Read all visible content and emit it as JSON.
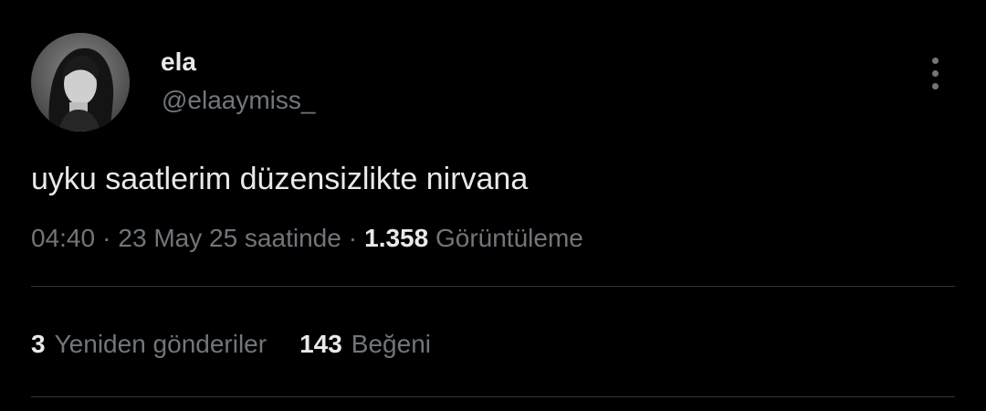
{
  "user": {
    "display_name": "ela",
    "handle": "@elaaymiss_"
  },
  "tweet": {
    "text": "uyku saatlerim düzensizlikte nirvana"
  },
  "meta": {
    "time": "04:40",
    "separator": "·",
    "date": "23 May 25 saatinde",
    "views_count": "1.358",
    "views_label": "Görüntüleme"
  },
  "stats": {
    "retweets_count": "3",
    "retweets_label": "Yeniden gönderiler",
    "likes_count": "143",
    "likes_label": "Beğeni"
  },
  "icons": {
    "more": "more-vertical-icon"
  },
  "colors": {
    "background": "#000000",
    "primary_text": "#e7e9ea",
    "secondary_text": "#71767b",
    "divider": "#2f3336"
  }
}
